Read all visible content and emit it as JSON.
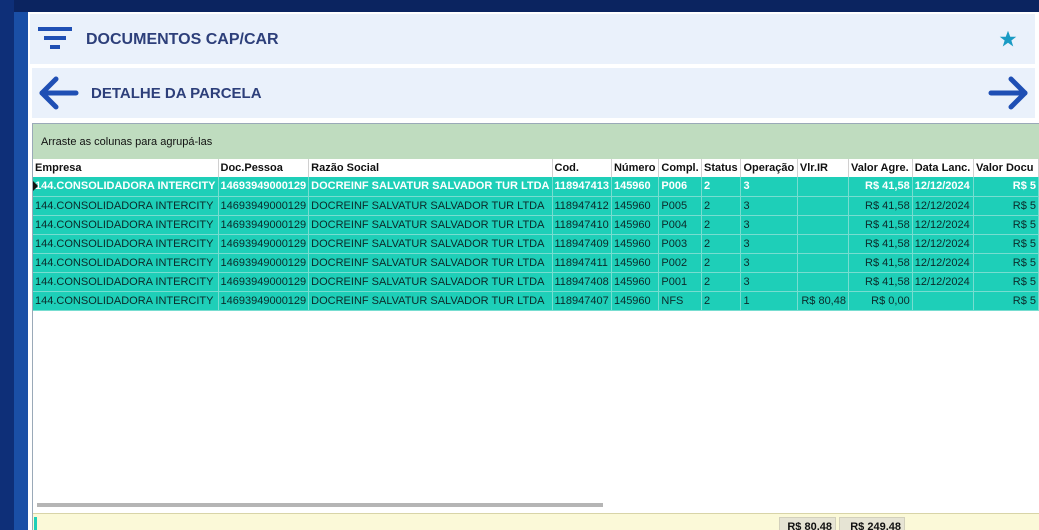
{
  "header": {
    "title": "DOCUMENTOS CAP/CAR",
    "filter_icon": "filter-icon",
    "star_icon": "star-icon"
  },
  "subheader": {
    "title": "DETALHE DA PARCELA",
    "left_icon": "arrow-left-icon",
    "right_icon": "arrow-right-icon"
  },
  "grid": {
    "group_hint": "Arraste as colunas para agrupá-las",
    "columns": [
      "Empresa",
      "Doc.Pessoa",
      "Razão Social",
      "Cod.",
      "Número",
      "Compl.",
      "Status",
      "Operação",
      "Vlr.IR",
      "Valor Agre.",
      "Data Lanc.",
      "Valor Docu"
    ],
    "rows": [
      [
        "144.CONSOLIDADORA INTERCITY",
        "14693949000129",
        "DOCREINF SALVATUR SALVADOR TUR LTDA",
        "118947413",
        "145960",
        "P006",
        "2",
        "3",
        "",
        "R$ 41,58",
        "12/12/2024",
        "R$ 5"
      ],
      [
        "144.CONSOLIDADORA INTERCITY",
        "14693949000129",
        "DOCREINF SALVATUR SALVADOR TUR LTDA",
        "118947412",
        "145960",
        "P005",
        "2",
        "3",
        "",
        "R$ 41,58",
        "12/12/2024",
        "R$ 5"
      ],
      [
        "144.CONSOLIDADORA INTERCITY",
        "14693949000129",
        "DOCREINF SALVATUR SALVADOR TUR LTDA",
        "118947410",
        "145960",
        "P004",
        "2",
        "3",
        "",
        "R$ 41,58",
        "12/12/2024",
        "R$ 5"
      ],
      [
        "144.CONSOLIDADORA INTERCITY",
        "14693949000129",
        "DOCREINF SALVATUR SALVADOR TUR LTDA",
        "118947409",
        "145960",
        "P003",
        "2",
        "3",
        "",
        "R$ 41,58",
        "12/12/2024",
        "R$ 5"
      ],
      [
        "144.CONSOLIDADORA INTERCITY",
        "14693949000129",
        "DOCREINF SALVATUR SALVADOR TUR LTDA",
        "118947411",
        "145960",
        "P002",
        "2",
        "3",
        "",
        "R$ 41,58",
        "12/12/2024",
        "R$ 5"
      ],
      [
        "144.CONSOLIDADORA INTERCITY",
        "14693949000129",
        "DOCREINF SALVATUR SALVADOR TUR LTDA",
        "118947408",
        "145960",
        "P001",
        "2",
        "3",
        "",
        "R$ 41,58",
        "12/12/2024",
        "R$ 5"
      ],
      [
        "144.CONSOLIDADORA INTERCITY",
        "14693949000129",
        "DOCREINF SALVATUR SALVADOR TUR LTDA",
        "118947407",
        "145960",
        "NFS",
        "2",
        "1",
        "R$ 80,48",
        "R$ 0,00",
        "",
        "R$ 5"
      ]
    ],
    "numeric_columns": [
      8,
      9,
      11
    ],
    "selected_row": 0
  },
  "footer": {
    "total_ir": "R$ 80,48",
    "total_agre": "R$ 249,48"
  },
  "colors": {
    "row_bg": "#1ecfb8",
    "title_text": "#2d3f7a",
    "accent_blue": "#1f4fb4",
    "star": "#1a9bc4"
  }
}
